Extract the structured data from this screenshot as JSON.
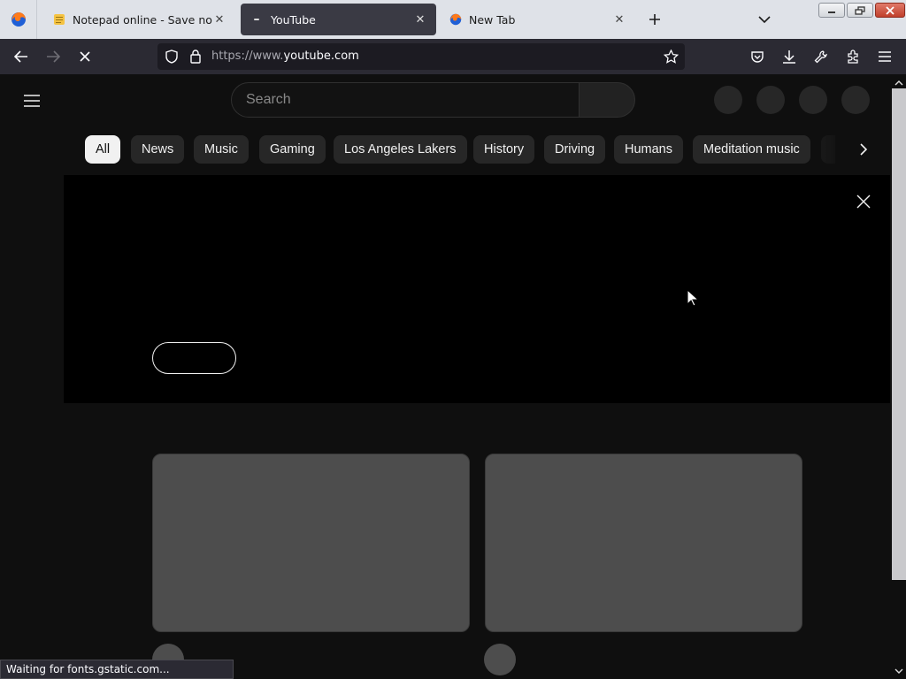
{
  "browser": {
    "tabs": [
      {
        "title": "Notepad online - Save notes on",
        "favicon": "notepad-favicon",
        "active": false
      },
      {
        "title": "YouTube",
        "favicon": "loading-dot",
        "active": true
      },
      {
        "title": "New Tab",
        "favicon": "firefox-icon",
        "active": false
      }
    ],
    "url": {
      "prefix": "https://www.",
      "domain": "youtube.com"
    },
    "status_text": "Waiting for fonts.gstatic.com...",
    "colors": {
      "tabbar": "#dfe2e8",
      "toolbar": "#2b2a33",
      "urlbar": "#1c1b22"
    }
  },
  "youtube": {
    "search_placeholder": "Search",
    "chips": [
      "All",
      "News",
      "Music",
      "Gaming",
      "Los Angeles Lakers",
      "History",
      "Driving",
      "Humans",
      "Meditation music"
    ],
    "colors": {
      "background": "#0f0f0f",
      "chip": "#272727",
      "chip_active": "#f1f1f1",
      "placeholder_block": "#4d4d4d"
    }
  }
}
